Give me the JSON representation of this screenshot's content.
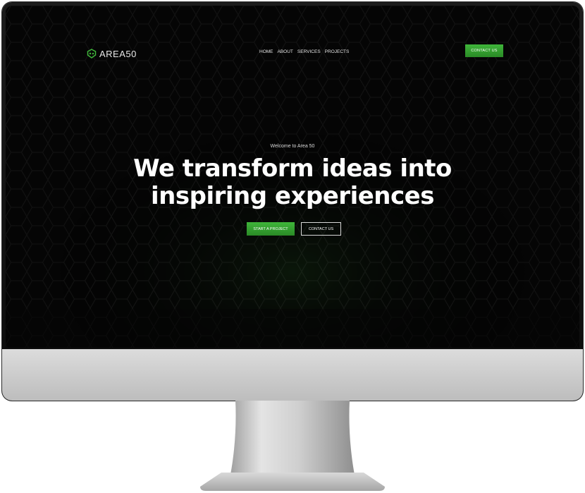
{
  "brand": {
    "name": "AREA50",
    "logo_icon": "alien-head-icon"
  },
  "nav": {
    "links": [
      "HOME",
      "ABOUT",
      "SERVICES",
      "PROJECTS"
    ],
    "cta_label": "CONTACT US"
  },
  "hero": {
    "kicker": "Welcome to Area 50",
    "title_line1": "We transform ideas into",
    "title_line2": "inspiring experiences",
    "primary_label": "START A PROJECT",
    "secondary_label": "CONTACT US"
  },
  "colors": {
    "accent": "#3fb53a",
    "screen_bg": "#050505",
    "hex_glow": "#2f8f2a"
  }
}
